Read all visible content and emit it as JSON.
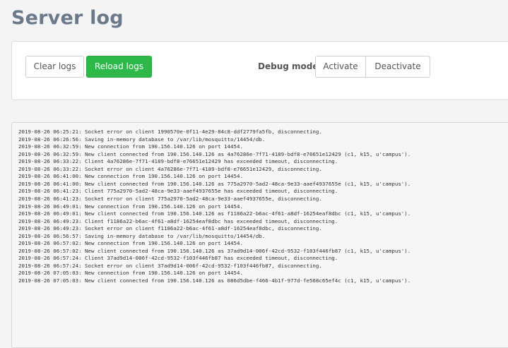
{
  "page": {
    "title": "Server log"
  },
  "toolbar": {
    "clear_label": "Clear logs",
    "reload_label": "Reload logs",
    "debug_label": "Debug mode",
    "activate_label": "Activate",
    "deactivate_label": "Deactivate"
  },
  "colors": {
    "title": "#6b7a8a",
    "reload_button": "#2db94a",
    "log_background": "#f6f6f6"
  },
  "log": {
    "lines": [
      "2019-08-26 06:25:21: Socket error on client 1990570e-0f11-4e29-84c8-ddf2779fa5fb, disconnecting.",
      "2019-08-26 06:26:56: Saving in-memory database to /var/lib/mosquitto/14454/db.",
      "2019-08-26 06:32:59: New connection from 190.156.140.126 on port 14454.",
      "2019-08-26 06:32:59: New client connected from 190.156.140.126 as 4a76286e-7f71-4189-bdf8-e76651e12429 (c1, k15, u'campus').",
      "2019-08-26 06:33:22: Client 4a76286e-7f71-4189-bdf8-e76651e12429 has exceeded timeout, disconnecting.",
      "2019-08-26 06:33:22: Socket error on client 4a76286e-7f71-4189-bdf8-e76651e12429, disconnecting.",
      "2019-08-26 06:41:00: New connection from 190.156.140.126 on port 14454.",
      "2019-08-26 06:41:00: New client connected from 190.156.140.126 as 775a2970-5ad2-48ca-9e33-aaef4937655e (c1, k15, u'campus').",
      "2019-08-26 06:41:23: Client 775a2970-5ad2-48ca-9e33-aaef4937655e has exceeded timeout, disconnecting.",
      "2019-08-26 06:41:23: Socket error on client 775a2970-5ad2-48ca-9e33-aaef4937655e, disconnecting.",
      "2019-08-26 06:49:01: New connection from 190.156.140.126 on port 14454.",
      "2019-08-26 06:49:01: New client connected from 190.156.140.126 as f1186a22-b6ac-4f61-a8df-16254eaf8dbc (c1, k15, u'campus').",
      "2019-08-26 06:49:23: Client f1186a22-b6ac-4f61-a8df-16254eaf8dbc has exceeded timeout, disconnecting.",
      "2019-08-26 06:49:23: Socket error on client f1186a22-b6ac-4f61-a8df-16254eaf8dbc, disconnecting.",
      "2019-08-26 06:56:57: Saving in-memory database to /var/lib/mosquitto/14454/db.",
      "2019-08-26 06:57:02: New connection from 190.156.140.126 on port 14454.",
      "2019-08-26 06:57:02: New client connected from 190.156.140.126 as 37ad9d14-006f-42cd-9532-f103f446fb87 (c1, k15, u'campus').",
      "2019-08-26 06:57:24: Client 37ad9d14-006f-42cd-9532-f103f446fb87 has exceeded timeout, disconnecting.",
      "2019-08-26 06:57:24: Socket error on client 37ad9d14-006f-42cd-9532-f103f446fb87, disconnecting.",
      "2019-08-26 07:05:03: New connection from 190.156.140.126 on port 14454.",
      "2019-08-26 07:05:03: New client connected from 190.156.140.126 as 086d5dbe-f466-4b1f-977d-fe568c65ef4c (c1, k15, u'campus')."
    ]
  }
}
